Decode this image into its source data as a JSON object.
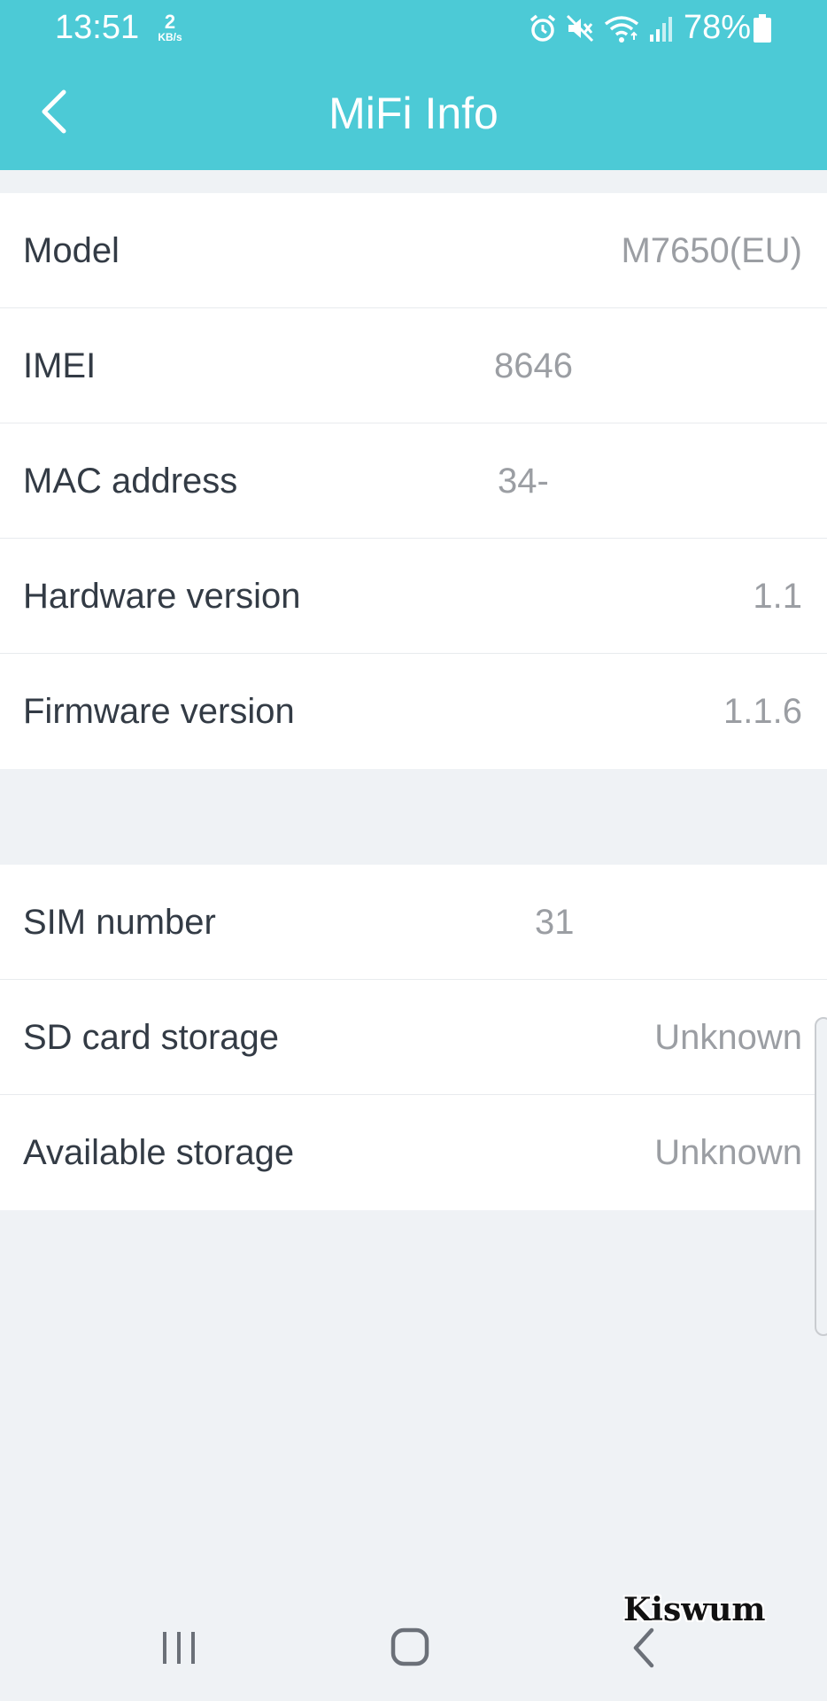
{
  "status_bar": {
    "time": "13:51",
    "speed_value": "2",
    "speed_unit": "KB/s",
    "battery": "78%",
    "icons": [
      "alarm-icon",
      "mute-icon",
      "wifi-icon",
      "signal-icon",
      "battery-icon"
    ]
  },
  "app_bar": {
    "title": "MiFi Info",
    "back_icon": "chevron-left-icon",
    "background": "#4ccad6"
  },
  "device_info": [
    {
      "label": "Model",
      "value": "M7650(EU)"
    },
    {
      "label": "IMEI",
      "value": "8646"
    },
    {
      "label": "MAC address",
      "value": "34-"
    },
    {
      "label": "Hardware version",
      "value": "1.1"
    },
    {
      "label": "Firmware version",
      "value": "1.1.6"
    }
  ],
  "storage_info": [
    {
      "label": "SIM number",
      "value": "31"
    },
    {
      "label": "SD card storage",
      "value": "Unknown"
    },
    {
      "label": "Available storage",
      "value": "Unknown"
    }
  ],
  "watermark": "Kiswum",
  "nav_bar": {
    "buttons": [
      "recent-apps-icon",
      "home-icon",
      "back-icon"
    ]
  }
}
